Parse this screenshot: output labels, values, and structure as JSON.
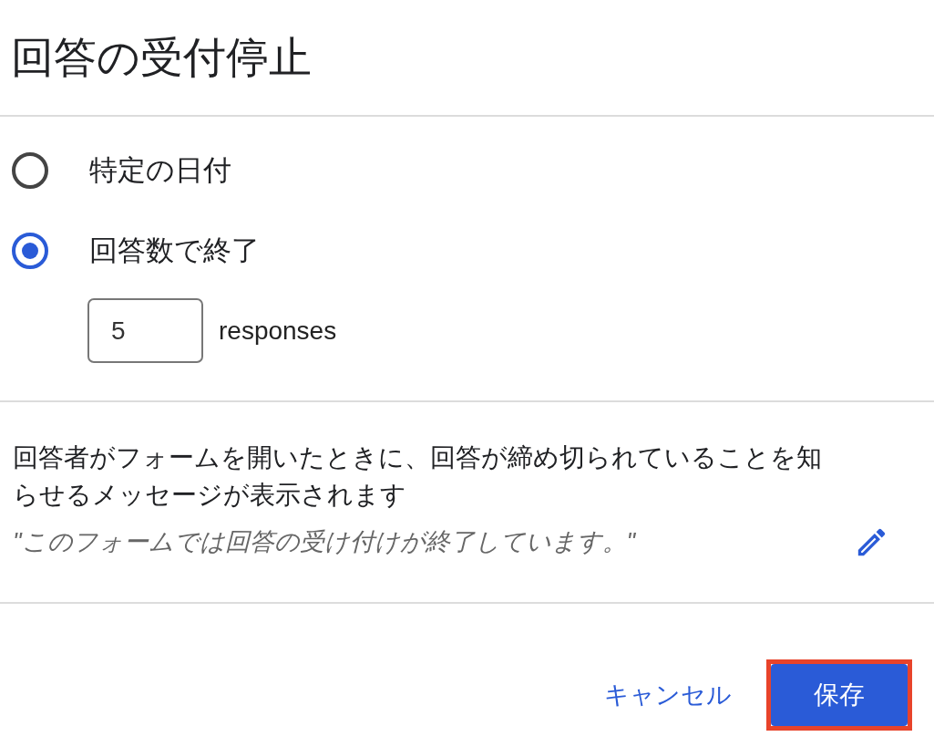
{
  "dialog": {
    "title": "回答の受付停止"
  },
  "options": [
    {
      "label": "特定の日付",
      "selected": false
    },
    {
      "label": "回答数で終了",
      "selected": true
    }
  ],
  "response_limit": {
    "value": "5",
    "unit": "responses"
  },
  "message": {
    "description": "回答者がフォームを開いたときに、回答が締め切られていることを知らせるメッセージが表示されます",
    "text": "\"このフォームでは回答の受け付けが終了しています。\""
  },
  "buttons": [
    {
      "label": "キャンセル",
      "kind": "text",
      "highlighted": false
    },
    {
      "label": "保存",
      "kind": "primary",
      "highlighted": true
    }
  ]
}
